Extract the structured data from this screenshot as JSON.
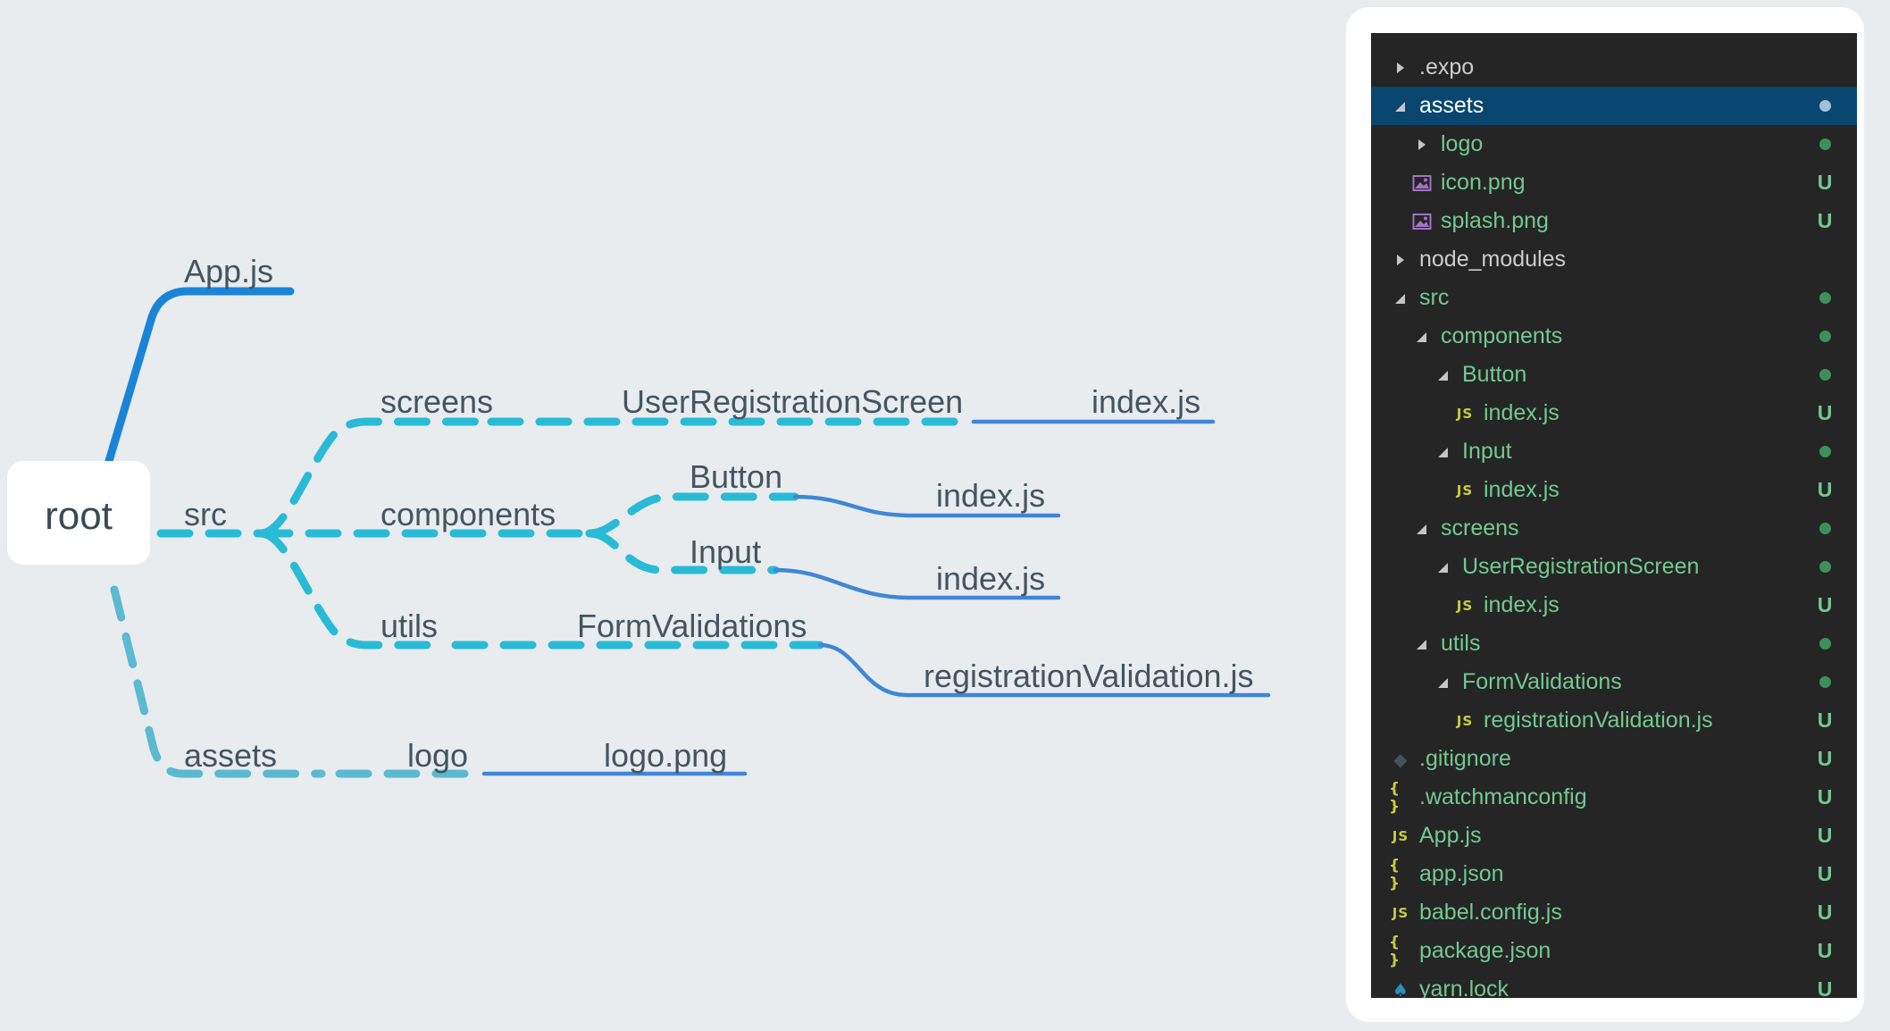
{
  "mindmap": {
    "root": "root",
    "nodes": {
      "appjs": "App.js",
      "src": "src",
      "screens": "screens",
      "user_registration_screen": "UserRegistrationScreen",
      "screens_index": "index.js",
      "components": "components",
      "button": "Button",
      "button_index": "index.js",
      "input": "Input",
      "input_index": "index.js",
      "utils": "utils",
      "form_validations": "FormValidations",
      "registration_validation": "registrationValidation.js",
      "assets": "assets",
      "logo": "logo",
      "logo_png": "logo.png"
    },
    "colors": {
      "solid_blue": "#1a84d8",
      "solid_line": "#3f87d6",
      "dashed_cyan": "#29bbd6",
      "dashed_teal": "#5bb9d0",
      "root_box": "#ffffff"
    }
  },
  "explorer": {
    "colors": {
      "background": "#252526",
      "selected": "#094771",
      "untracked": "#73c991"
    },
    "rows": [
      {
        "label": ".expo",
        "indent": 0,
        "twisty": "collapsed",
        "icon": "",
        "status": "",
        "state": "plain"
      },
      {
        "label": "assets",
        "indent": 0,
        "twisty": "expanded",
        "icon": "",
        "status": "dot",
        "state": "selected"
      },
      {
        "label": "logo",
        "indent": 1,
        "twisty": "collapsed",
        "icon": "",
        "status": "dot",
        "state": "untracked"
      },
      {
        "label": "icon.png",
        "indent": 1,
        "twisty": "",
        "icon": "image-icon",
        "status": "U",
        "state": "untracked"
      },
      {
        "label": "splash.png",
        "indent": 1,
        "twisty": "",
        "icon": "image-icon",
        "status": "U",
        "state": "untracked"
      },
      {
        "label": "node_modules",
        "indent": 0,
        "twisty": "collapsed",
        "icon": "",
        "status": "",
        "state": "plain"
      },
      {
        "label": "src",
        "indent": 0,
        "twisty": "expanded",
        "icon": "",
        "status": "dot",
        "state": "untracked"
      },
      {
        "label": "components",
        "indent": 1,
        "twisty": "expanded",
        "icon": "",
        "status": "dot",
        "state": "untracked"
      },
      {
        "label": "Button",
        "indent": 2,
        "twisty": "expanded",
        "icon": "",
        "status": "dot",
        "state": "untracked"
      },
      {
        "label": "index.js",
        "indent": 3,
        "twisty": "",
        "icon": "js-icon",
        "status": "U",
        "state": "untracked"
      },
      {
        "label": "Input",
        "indent": 2,
        "twisty": "expanded",
        "icon": "",
        "status": "dot",
        "state": "untracked"
      },
      {
        "label": "index.js",
        "indent": 3,
        "twisty": "",
        "icon": "js-icon",
        "status": "U",
        "state": "untracked"
      },
      {
        "label": "screens",
        "indent": 1,
        "twisty": "expanded",
        "icon": "",
        "status": "dot",
        "state": "untracked"
      },
      {
        "label": "UserRegistrationScreen",
        "indent": 2,
        "twisty": "expanded",
        "icon": "",
        "status": "dot",
        "state": "untracked"
      },
      {
        "label": "index.js",
        "indent": 3,
        "twisty": "",
        "icon": "js-icon",
        "status": "U",
        "state": "untracked"
      },
      {
        "label": "utils",
        "indent": 1,
        "twisty": "expanded",
        "icon": "",
        "status": "dot",
        "state": "untracked"
      },
      {
        "label": "FormValidations",
        "indent": 2,
        "twisty": "expanded",
        "icon": "",
        "status": "dot",
        "state": "untracked"
      },
      {
        "label": "registrationValidation.js",
        "indent": 3,
        "twisty": "",
        "icon": "js-icon",
        "status": "U",
        "state": "untracked"
      },
      {
        "label": ".gitignore",
        "indent": 0,
        "twisty": "",
        "icon": "git-icon",
        "status": "U",
        "state": "untracked"
      },
      {
        "label": ".watchmanconfig",
        "indent": 0,
        "twisty": "",
        "icon": "json-icon",
        "status": "U",
        "state": "untracked"
      },
      {
        "label": "App.js",
        "indent": 0,
        "twisty": "",
        "icon": "js-icon",
        "status": "U",
        "state": "untracked"
      },
      {
        "label": "app.json",
        "indent": 0,
        "twisty": "",
        "icon": "json-icon",
        "status": "U",
        "state": "untracked"
      },
      {
        "label": "babel.config.js",
        "indent": 0,
        "twisty": "",
        "icon": "js-icon",
        "status": "U",
        "state": "untracked"
      },
      {
        "label": "package.json",
        "indent": 0,
        "twisty": "",
        "icon": "json-icon",
        "status": "U",
        "state": "untracked"
      },
      {
        "label": "yarn.lock",
        "indent": 0,
        "twisty": "",
        "icon": "yarn-icon",
        "status": "U",
        "state": "untracked"
      }
    ]
  }
}
